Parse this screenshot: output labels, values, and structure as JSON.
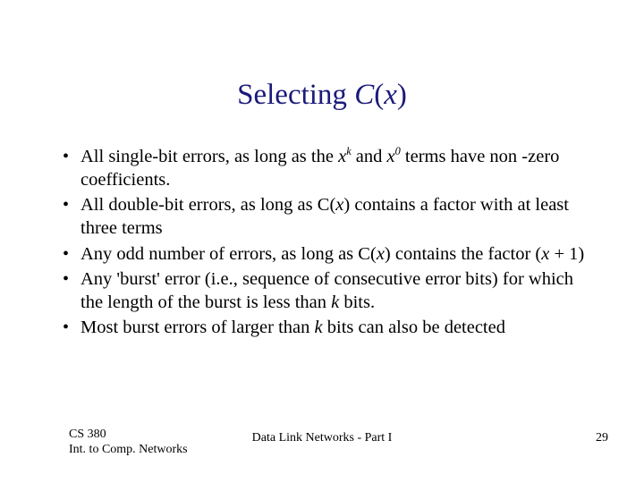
{
  "title": {
    "plain": "Selecting ",
    "func_letter": "C",
    "paren_open": "(",
    "var": "x",
    "paren_close": ")"
  },
  "bullets": [
    {
      "pre": "All single-bit errors, as long as the ",
      "t1_base": "x",
      "t1_sup": "k",
      "mid1": " and ",
      "t2_base": "x",
      "t2_sup": "0",
      "post": " terms have non -zero coefficients."
    },
    {
      "pre": "All double-bit errors, as long as ",
      "fn": "C",
      "paren_open": "(",
      "var": "x",
      "paren_close": ")",
      "post": " contains a factor with at least three terms"
    },
    {
      "pre": "Any odd number of errors, as long as ",
      "fn": "C",
      "paren_open": "(",
      "var": "x",
      "paren_close": ")",
      "post": " contains the factor (",
      "var2": "x",
      "post2": " + 1)"
    },
    {
      "pre": "Any 'burst' error (i.e., sequence of consecutive error bits) for which the length of the burst is less than ",
      "kvar": "k",
      "post": " bits."
    },
    {
      "pre": "Most burst errors of larger than ",
      "kvar": "k",
      "post": " bits can also be detected"
    }
  ],
  "footer": {
    "left_line1": " CS 380",
    "left_line2": "Int. to Comp. Networks",
    "center": "Data Link Networks - Part I",
    "right": "29"
  }
}
